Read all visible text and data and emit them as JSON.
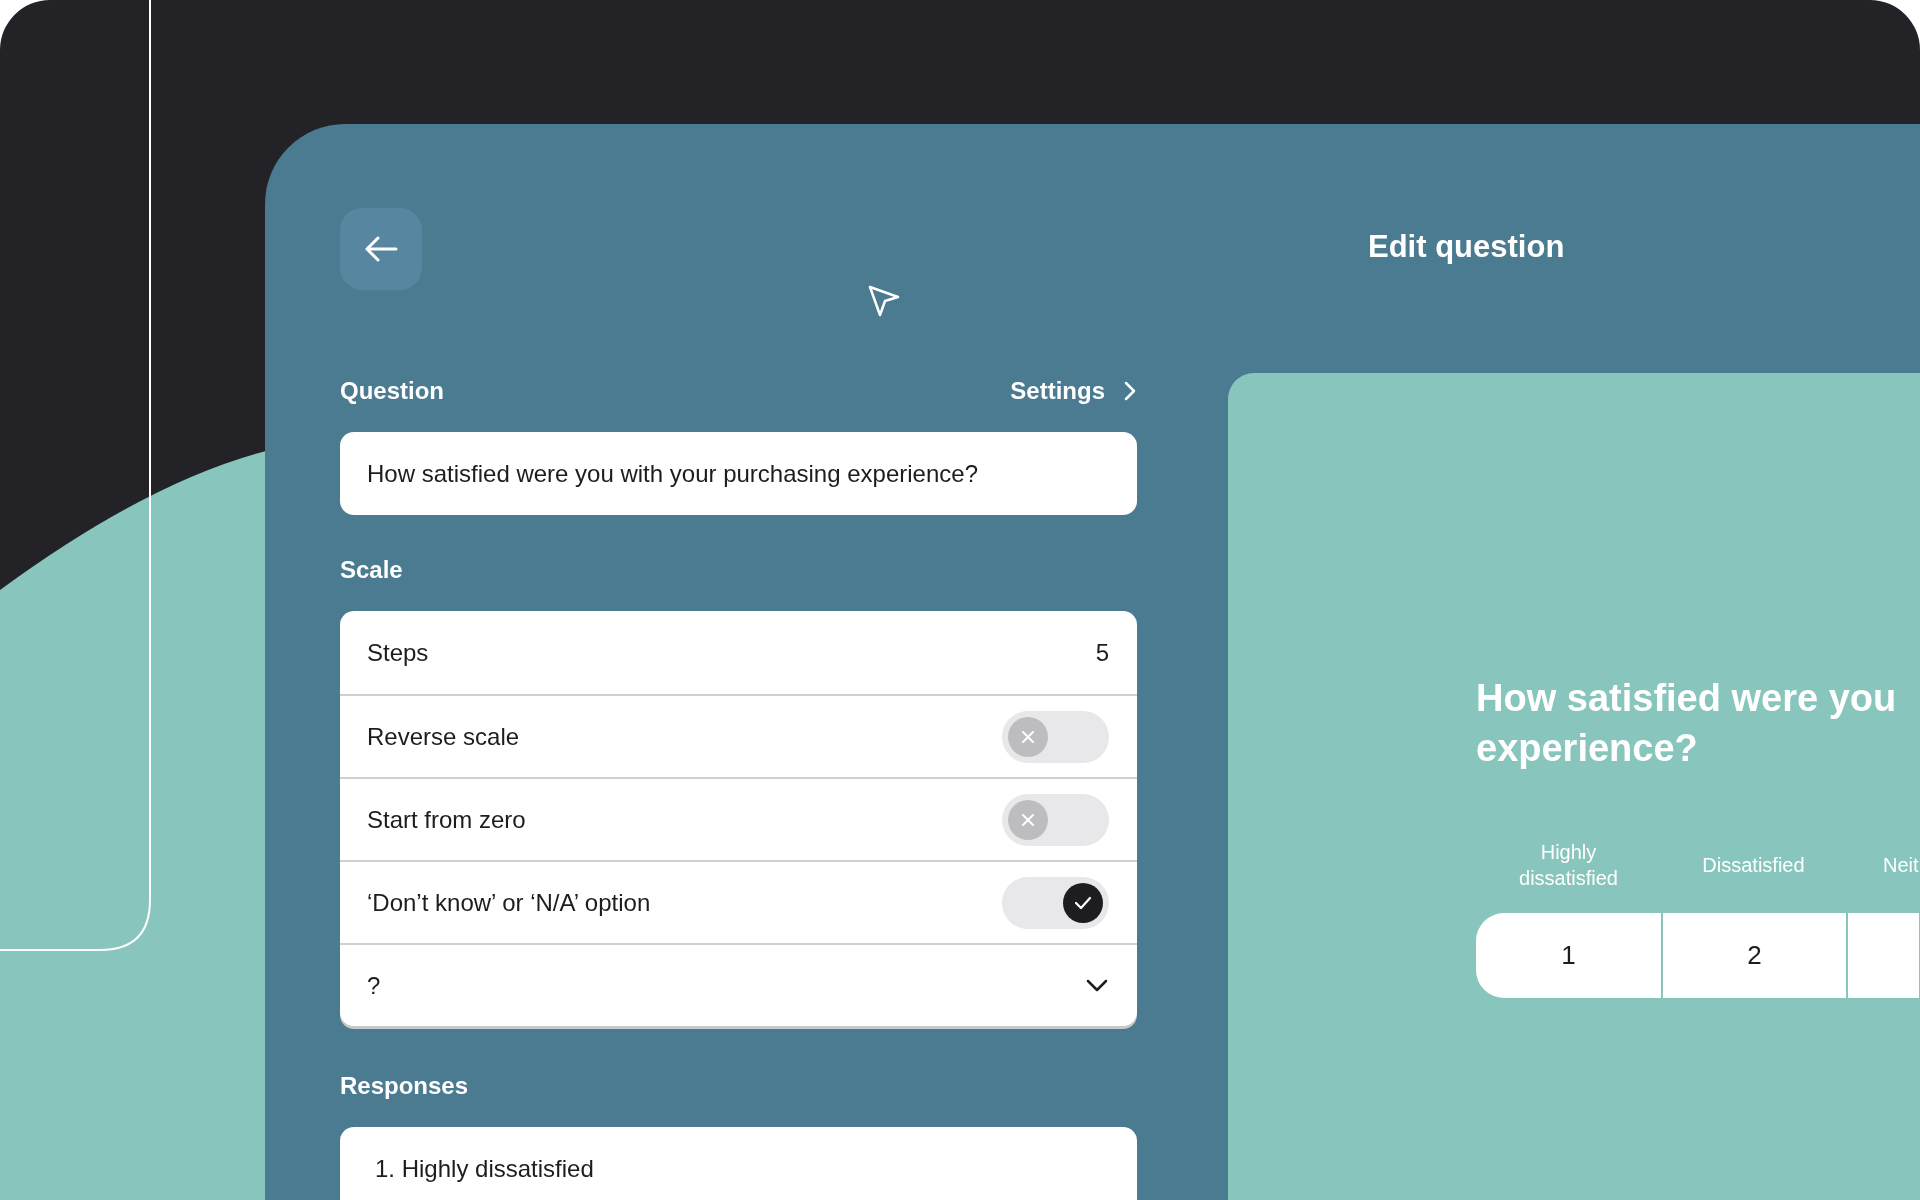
{
  "header": {
    "title": "Edit question"
  },
  "question": {
    "label": "Question",
    "settings_link": "Settings",
    "value": "How satisfied were you with your purchasing experience?"
  },
  "scale": {
    "label": "Scale",
    "rows": [
      {
        "kind": "value",
        "label": "Steps",
        "value": "5"
      },
      {
        "kind": "toggle",
        "label": "Reverse scale",
        "on": false
      },
      {
        "kind": "toggle",
        "label": "Start from zero",
        "on": false
      },
      {
        "kind": "toggle",
        "label": "‘Don’t know’ or ‘N/A’ option",
        "on": true
      },
      {
        "kind": "dropdown",
        "label": "?",
        "expanded": false
      }
    ]
  },
  "responses": {
    "label": "Responses",
    "items": [
      "1. Highly dissatisfied"
    ]
  },
  "preview": {
    "question_lines": [
      "How satisfied were you",
      "experience?"
    ],
    "options": [
      {
        "label": "Highly dissatisfied",
        "value": "1"
      },
      {
        "label": "Dissatisfied",
        "value": "2"
      },
      {
        "label": "Neit"
      }
    ]
  }
}
